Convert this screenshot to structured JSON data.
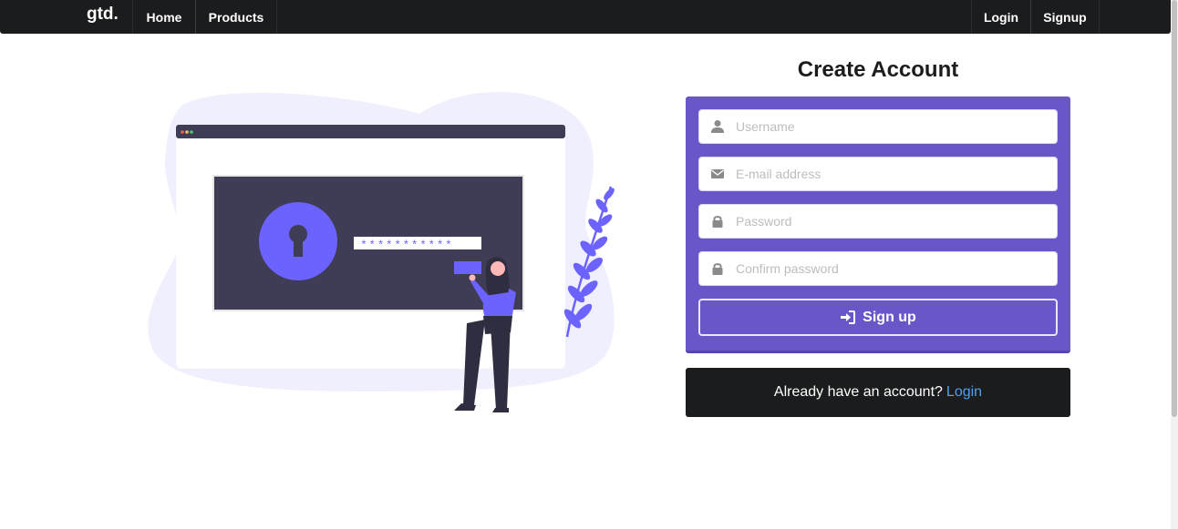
{
  "navbar": {
    "brand": "gtd.",
    "items": [
      {
        "label": "Home"
      },
      {
        "label": "Products"
      }
    ],
    "right_items": [
      {
        "label": "Login"
      },
      {
        "label": "Signup"
      }
    ]
  },
  "illustration": {
    "password_mask": "***********"
  },
  "form": {
    "title": "Create Account",
    "fields": [
      {
        "placeholder": "Username",
        "icon": "user-icon",
        "value": ""
      },
      {
        "placeholder": "E-mail address",
        "icon": "envelope-icon",
        "value": ""
      },
      {
        "placeholder": "Password",
        "icon": "lock-icon",
        "value": ""
      },
      {
        "placeholder": "Confirm password",
        "icon": "lock-icon",
        "value": ""
      }
    ],
    "submit_label": "Sign up",
    "submit_icon": "sign-in-icon"
  },
  "login_prompt": {
    "text": "Already have an account?",
    "link_label": "Login"
  },
  "colors": {
    "navbar_bg": "#1b1c1d",
    "accent": "#6957c9",
    "link": "#4ea0ee",
    "illustration_bg": "#f0effd",
    "illustration_dark": "#3f3d56",
    "illustration_purple": "#6c63ff"
  }
}
